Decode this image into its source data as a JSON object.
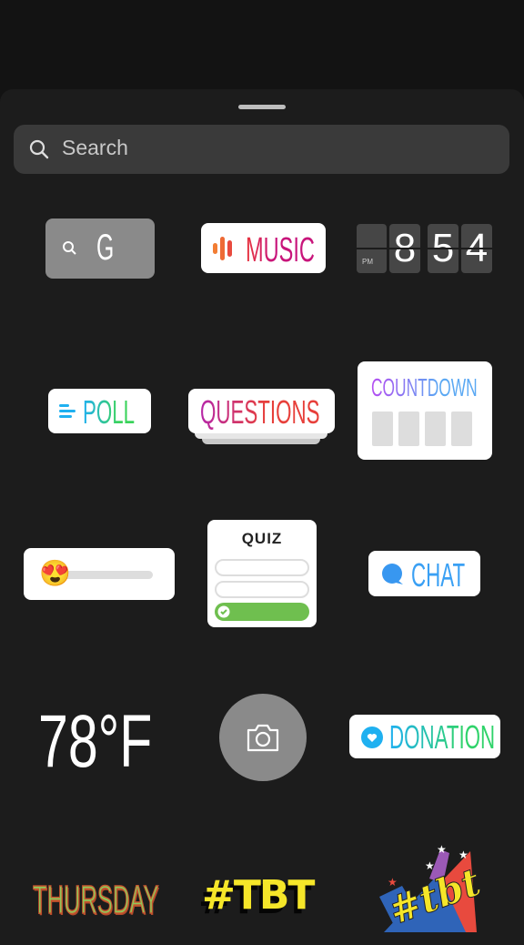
{
  "search": {
    "placeholder": "Search",
    "icon": "search-icon"
  },
  "stickers": {
    "gif": {
      "letter": "G",
      "icon": "search-icon"
    },
    "music": {
      "label": "MUSIC",
      "icon": "music-bars-icon"
    },
    "clock": {
      "ampm": "PM",
      "h": "8",
      "m1": "5",
      "m2": "4"
    },
    "poll": {
      "label": "POLL",
      "icon": "poll-bars-icon"
    },
    "questions": {
      "label": "QUESTIONS"
    },
    "countdown": {
      "label": "COUNTDOWN"
    },
    "emoji_slider": {
      "emoji": "😍"
    },
    "quiz": {
      "label": "QUIZ",
      "icon": "check-icon"
    },
    "chat": {
      "label": "CHAT",
      "icon": "chat-bubble-icon"
    },
    "weather": {
      "label": "78°F"
    },
    "camera": {
      "icon": "camera-icon"
    },
    "donation": {
      "label": "DONATION",
      "icon": "heart-icon"
    },
    "thursday": {
      "label": "THURSDAY"
    },
    "tbt": {
      "label": "#TBT"
    },
    "tbt_script": {
      "label": "#tbt"
    }
  },
  "colors": {
    "sheet": "#1c1c1c",
    "search_bg": "#3a3a3a",
    "quiz_green": "#6fbf4f",
    "chat_blue": "#3897f0"
  }
}
